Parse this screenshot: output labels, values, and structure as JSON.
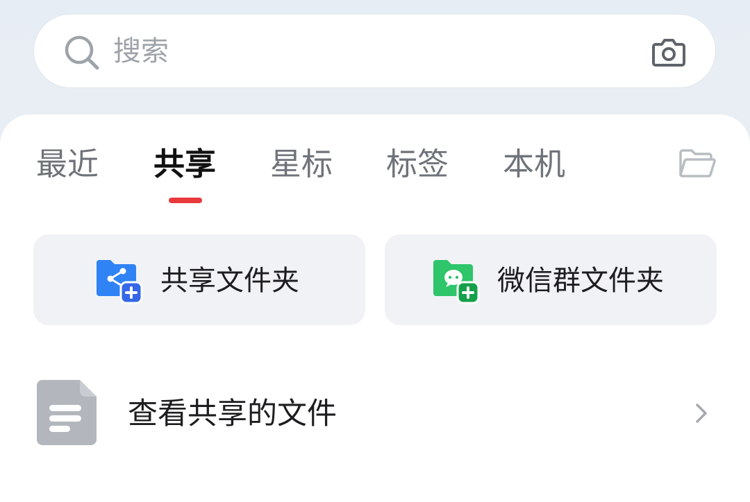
{
  "search": {
    "placeholder": "搜索",
    "left_icon": "search-icon",
    "right_icon": "camera-icon"
  },
  "tabs": [
    {
      "label": "最近",
      "active": false
    },
    {
      "label": "共享",
      "active": true
    },
    {
      "label": "星标",
      "active": false
    },
    {
      "label": "标签",
      "active": false
    },
    {
      "label": "本机",
      "active": false
    }
  ],
  "tab_indicator_color": "#e8393c",
  "tab_right_icon": "folder-open-icon",
  "cards": [
    {
      "label": "共享文件夹",
      "icon": "shared-folder-add-icon",
      "color": "#2f83f5"
    },
    {
      "label": "微信群文件夹",
      "icon": "wechat-folder-add-icon",
      "color": "#1fba5a"
    }
  ],
  "list": [
    {
      "label": "查看共享的文件",
      "icon": "document-icon",
      "trailing_icon": "chevron-right-icon"
    }
  ]
}
